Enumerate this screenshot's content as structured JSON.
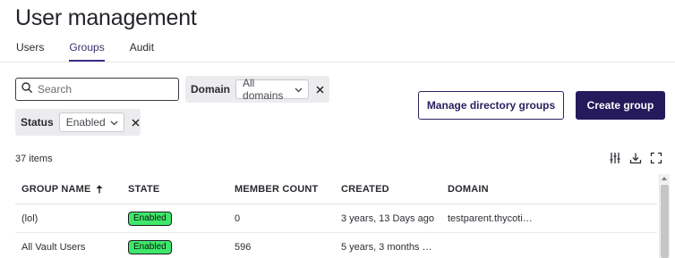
{
  "page": {
    "title": "User management"
  },
  "tabs": [
    {
      "label": "Users",
      "active": false
    },
    {
      "label": "Groups",
      "active": true
    },
    {
      "label": "Audit",
      "active": false
    }
  ],
  "search": {
    "placeholder": "Search",
    "value": "",
    "icon": "search-icon"
  },
  "filters": {
    "domain": {
      "label": "Domain",
      "value": "All domains"
    },
    "status": {
      "label": "Status",
      "value": "Enabled"
    }
  },
  "actions": {
    "manage_directory_groups": "Manage directory groups",
    "create_group": "Create group"
  },
  "table": {
    "item_count": "37 items",
    "tools": [
      "column-settings-icon",
      "download-icon",
      "fullscreen-icon"
    ],
    "columns": [
      "GROUP NAME",
      "STATE",
      "MEMBER COUNT",
      "CREATED",
      "DOMAIN"
    ],
    "sort": {
      "column": "GROUP NAME",
      "direction": "ascending"
    },
    "rows": [
      {
        "group_name": "(lol)",
        "state": "Enabled",
        "member_count": "0",
        "created": "3 years, 13 Days ago",
        "domain": "testparent.thycoti…"
      },
      {
        "group_name": "All Vault Users",
        "state": "Enabled",
        "member_count": "596",
        "created": "5 years, 3 months a…",
        "domain": ""
      }
    ]
  },
  "colors": {
    "accent": "#241a5c",
    "tab_underline": "#3a2f8a",
    "badge_enabled": "#3ee86a"
  }
}
